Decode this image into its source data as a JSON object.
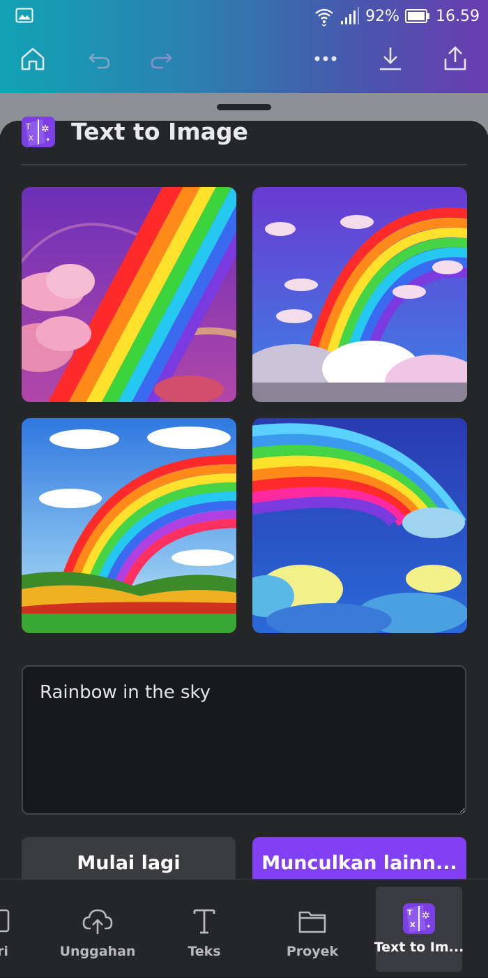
{
  "status_bar": {
    "battery": "92%",
    "time": "16.59"
  },
  "icons": {
    "gallery": "image-icon",
    "wifi": "wifi-icon",
    "signal": "signal-icon",
    "battery": "battery-icon",
    "home": "home-icon",
    "undo": "undo-icon",
    "redo": "redo-icon",
    "more": "more-icon",
    "download": "download-icon",
    "share": "share-icon"
  },
  "panel": {
    "title": "Text to Image"
  },
  "results": [
    {
      "alt": "Rainbow with pink clouds on purple sky"
    },
    {
      "alt": "Rainbow arch with clouds in starry blue sky"
    },
    {
      "alt": "Rainbow over green hills"
    },
    {
      "alt": "Bright rainbow arch above clouds"
    }
  ],
  "prompt": {
    "value": "Rainbow in the sky"
  },
  "buttons": {
    "restart": "Mulai lagi",
    "generate_more": "Munculkan lainn..."
  },
  "bottom_nav": [
    {
      "label": "ri",
      "icon": "partial-icon"
    },
    {
      "label": "Unggahan",
      "icon": "upload-cloud-icon"
    },
    {
      "label": "Teks",
      "icon": "text-icon"
    },
    {
      "label": "Proyek",
      "icon": "folder-icon"
    },
    {
      "label": "Text to Im...",
      "icon": "text-to-image-icon",
      "active": true
    }
  ],
  "colors": {
    "accent": "#8141f2",
    "panel": "#252628",
    "header_start": "#11a3b4",
    "header_end": "#6a3cb0"
  }
}
